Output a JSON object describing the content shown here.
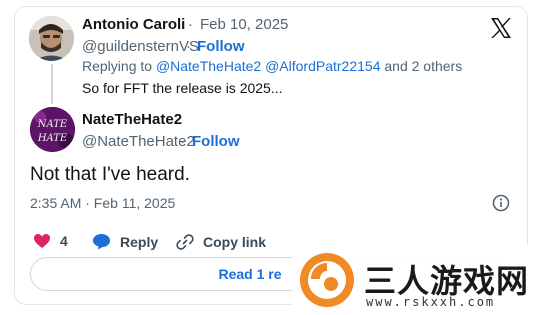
{
  "parent_tweet": {
    "author_name": "Antonio Caroli",
    "separator": "·",
    "date": "Feb 10, 2025",
    "handle": "@guildensternVS",
    "follow_label": "Follow",
    "replying_prefix": "Replying to",
    "replying_users": "@NateTheHate2 @AlfordPatr22154",
    "replying_suffix": "and 2 others",
    "text": "So for FFT the release is 2025..."
  },
  "main_tweet": {
    "author_name": "NateTheHate2",
    "handle": "@NateTheHate2",
    "follow_label": "Follow",
    "text": "Not that I've heard.",
    "timestamp": "2:35 AM · Feb 11, 2025",
    "like_count": "4",
    "reply_label": "Reply",
    "copy_link_label": "Copy link",
    "read_replies_label": "Read 1 re"
  },
  "avatar_text": {
    "line1": "NATE",
    "line2": "HATE"
  },
  "watermark": {
    "brand": "三人游戏网",
    "url": "www.rskxxh.com"
  },
  "colors": {
    "accent": "#1d6ed8",
    "like": "#e0245e",
    "watermark_orange": "#f08a24"
  },
  "icons": [
    "x-logo-icon",
    "info-icon",
    "heart-icon",
    "reply-bubble-icon",
    "link-icon"
  ]
}
